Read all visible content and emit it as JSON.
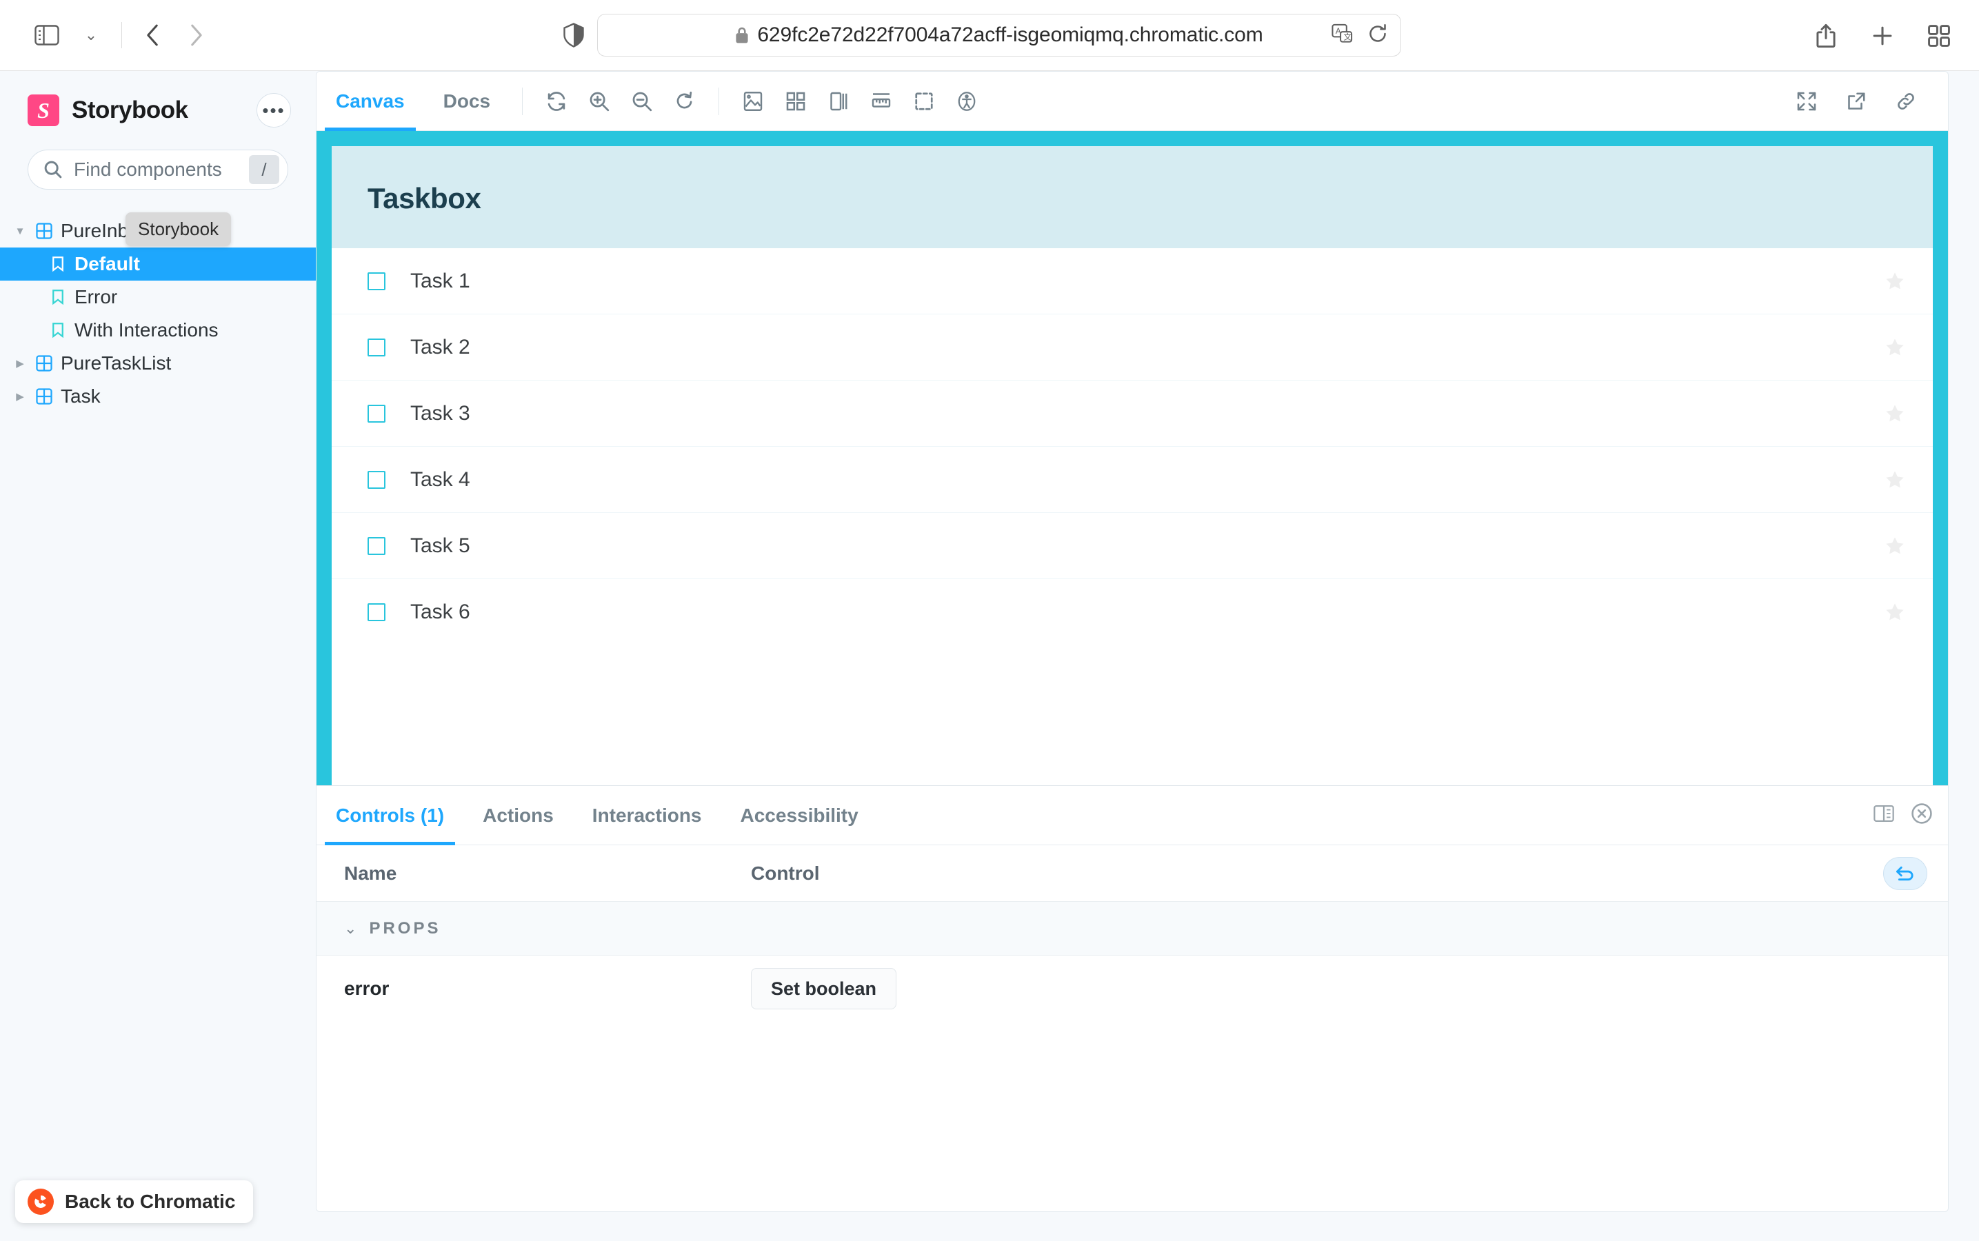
{
  "browser": {
    "url": "629fc2e72d22f7004a72acff-isgeomiqmq.chromatic.com",
    "icons": {
      "sidebar_toggle": "sidebar-toggle-icon",
      "tab_overview_chevron": "chevron-down-icon",
      "back": "back-arrow-icon",
      "forward": "forward-arrow-icon",
      "shield": "shield-icon",
      "lock": "lock-icon",
      "translate": "translate-icon",
      "reload": "reload-icon",
      "share": "share-icon",
      "new_tab": "plus-icon",
      "tab_grid": "tab-overview-icon"
    }
  },
  "sidebar": {
    "brand": "Storybook",
    "menu_label": "•••",
    "tooltip": "Storybook",
    "search_placeholder": "Find components",
    "search_value": "",
    "search_shortcut": "/",
    "tree": [
      {
        "label": "PureInboxScreen",
        "type": "component",
        "expanded": true,
        "selected": false
      },
      {
        "label": "Default",
        "type": "story",
        "expanded": false,
        "selected": true
      },
      {
        "label": "Error",
        "type": "story",
        "expanded": false,
        "selected": false
      },
      {
        "label": "With Interactions",
        "type": "story",
        "expanded": false,
        "selected": false
      },
      {
        "label": "PureTaskList",
        "type": "component",
        "expanded": false,
        "selected": false
      },
      {
        "label": "Task",
        "type": "component",
        "expanded": false,
        "selected": false
      }
    ],
    "chromatic_button": "Back to Chromatic"
  },
  "toolbar": {
    "tabs": [
      {
        "label": "Canvas",
        "active": true
      },
      {
        "label": "Docs",
        "active": false
      }
    ],
    "icons": [
      "remount-icon",
      "zoom-in-icon",
      "zoom-out-icon",
      "zoom-reset-icon",
      "backgrounds-icon",
      "grid-icon",
      "viewport-icon",
      "measure-icon",
      "outline-icon",
      "accessibility-icon"
    ],
    "right_icons": [
      "fullscreen-icon",
      "open-new-tab-icon",
      "copy-link-icon"
    ]
  },
  "preview": {
    "background_color": "#29c5dd",
    "header_color": "#d6ecf2",
    "title": "Taskbox",
    "tasks": [
      {
        "title": "Task 1",
        "checked": false,
        "pinned": false
      },
      {
        "title": "Task 2",
        "checked": false,
        "pinned": false
      },
      {
        "title": "Task 3",
        "checked": false,
        "pinned": false
      },
      {
        "title": "Task 4",
        "checked": false,
        "pinned": false
      },
      {
        "title": "Task 5",
        "checked": false,
        "pinned": false
      },
      {
        "title": "Task 6",
        "checked": false,
        "pinned": false
      }
    ]
  },
  "panel": {
    "tabs": [
      {
        "label": "Controls (1)",
        "active": true
      },
      {
        "label": "Actions",
        "active": false
      },
      {
        "label": "Interactions",
        "active": false
      },
      {
        "label": "Accessibility",
        "active": false
      }
    ],
    "right_icons": [
      "panel-position-icon",
      "close-panel-icon"
    ],
    "table": {
      "columns": [
        "Name",
        "Control"
      ],
      "reset_icon": "undo-icon",
      "section": {
        "label": "PROPS",
        "expanded": true
      },
      "rows": [
        {
          "name": "error",
          "control_label": "Set boolean",
          "control_type": "boolean"
        }
      ]
    }
  },
  "colors": {
    "accent_blue": "#1ea7fd",
    "storybook_pink": "#ff4785",
    "chromatic_orange": "#fc521f",
    "canvas_cyan": "#29c5dd",
    "canvas_header": "#d6ecf2"
  }
}
